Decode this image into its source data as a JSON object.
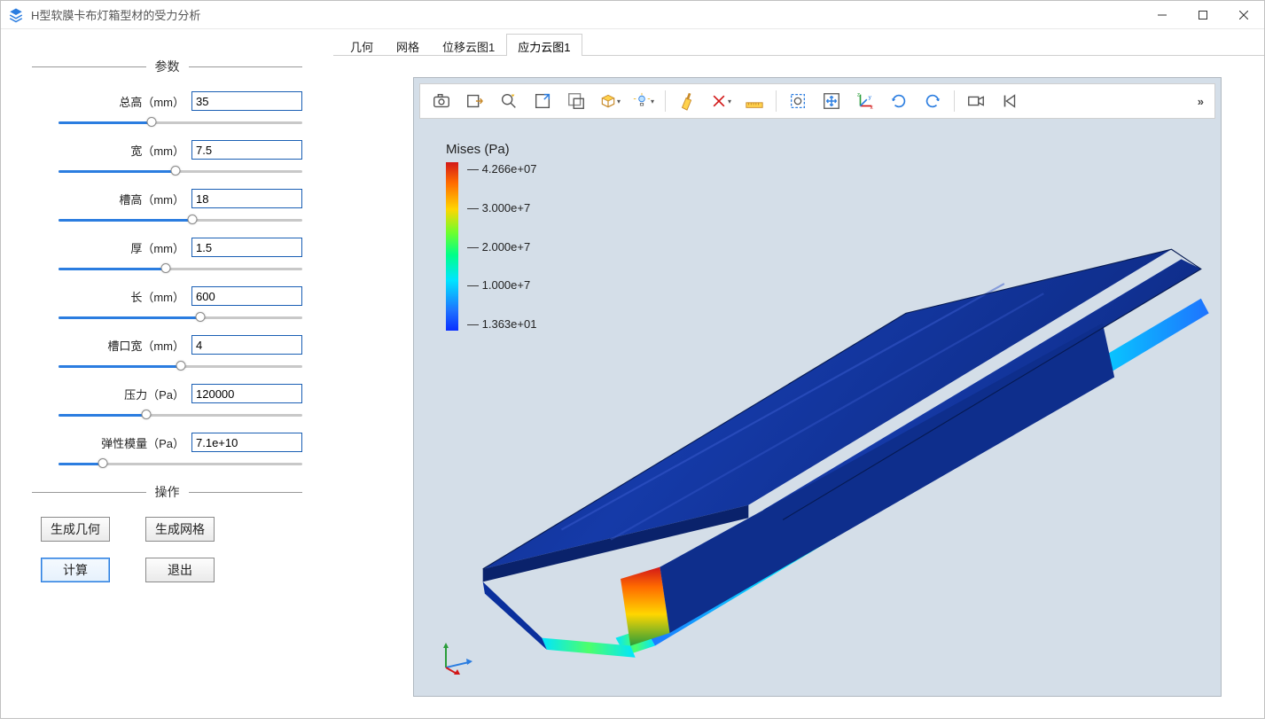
{
  "window": {
    "title": "H型软膜卡布灯箱型材的受力分析"
  },
  "sidebar": {
    "section_params": "参数",
    "section_ops": "操作",
    "params": [
      {
        "label": "总高（mm）",
        "value": "35",
        "slider_pct": 38
      },
      {
        "label": "宽（mm）",
        "value": "7.5",
        "slider_pct": 48
      },
      {
        "label": "槽高（mm）",
        "value": "18",
        "slider_pct": 55
      },
      {
        "label": "厚（mm）",
        "value": "1.5",
        "slider_pct": 44
      },
      {
        "label": "长（mm）",
        "value": "600",
        "slider_pct": 58
      },
      {
        "label": "槽口宽（mm）",
        "value": "4",
        "slider_pct": 50
      },
      {
        "label": "压力（Pa）",
        "value": "120000",
        "slider_pct": 36
      },
      {
        "label": "弹性模量（Pa）",
        "value": "7.1e+10",
        "slider_pct": 18
      }
    ],
    "buttons": {
      "gen_geometry": "生成几何",
      "gen_mesh": "生成网格",
      "compute": "计算",
      "exit": "退出"
    }
  },
  "tabs": [
    {
      "id": "geometry",
      "label": "几何",
      "active": false
    },
    {
      "id": "mesh",
      "label": "网格",
      "active": false
    },
    {
      "id": "disp1",
      "label": "位移云图1",
      "active": false
    },
    {
      "id": "stress1",
      "label": "应力云图1",
      "active": true
    }
  ],
  "toolbar_icons": [
    "camera-icon",
    "export-icon",
    "fast-zoom-icon",
    "zoom-box-icon",
    "select-box-icon",
    "transparency-icon",
    "light-icon",
    "clear-icon",
    "delete-icon",
    "measure-icon",
    "marquee-icon",
    "fit-view-icon",
    "axes-icon",
    "rotate-cw-icon",
    "rotate-ccw-icon",
    "video-camera-icon",
    "skip-start-icon"
  ],
  "toolbar_more": "»",
  "legend": {
    "title": "Mises (Pa)",
    "ticks": [
      "4.266e+07",
      "3.000e+7",
      "2.000e+7",
      "1.000e+7",
      "1.363e+01"
    ]
  }
}
